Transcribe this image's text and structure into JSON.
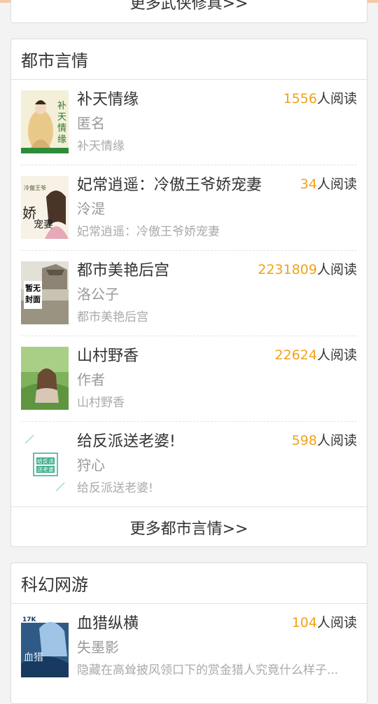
{
  "colors": {
    "accent": "#f0a21a",
    "topbar": "#f5c9a6"
  },
  "prev_section": {
    "more_label": "更多武侠修真>>"
  },
  "dushi": {
    "title": "都市言情",
    "more_label": "更多都市言情>>",
    "books": [
      {
        "title": "补天情缘",
        "author": "匿名",
        "desc": "补天情缘",
        "reads": "1556",
        "reads_suffix": "人阅读",
        "cover_text": "补天情缘"
      },
      {
        "title": "妃常逍遥：冷傲王爷娇宠妻",
        "author": "泠湜",
        "desc": "妃常逍遥：冷傲王爷娇宠妻",
        "reads": "34",
        "reads_suffix": "人阅读",
        "cover_text": "娇宠妻"
      },
      {
        "title": "都市美艳后宫",
        "author": "洛公子",
        "desc": "都市美艳后宫",
        "reads": "2231809",
        "reads_suffix": "人阅读",
        "cover_text": "暂无封面"
      },
      {
        "title": "山村野香",
        "author": "作者",
        "desc": "山村野香",
        "reads": "22624",
        "reads_suffix": "人阅读",
        "cover_text": ""
      },
      {
        "title": "给反派送老婆!",
        "author": "狩心",
        "desc": "给反派送老婆!",
        "reads": "598",
        "reads_suffix": "人阅读",
        "cover_text": "给反派送老婆"
      }
    ]
  },
  "kehuan": {
    "title": "科幻网游",
    "books": [
      {
        "title": "血猎纵横",
        "author": "失墨影",
        "desc": "隐藏在高耸披风领口下的赏金猎人究竟什么样子...",
        "reads": "104",
        "reads_suffix": "人阅读",
        "cover_text": "血猎纵横"
      }
    ]
  }
}
